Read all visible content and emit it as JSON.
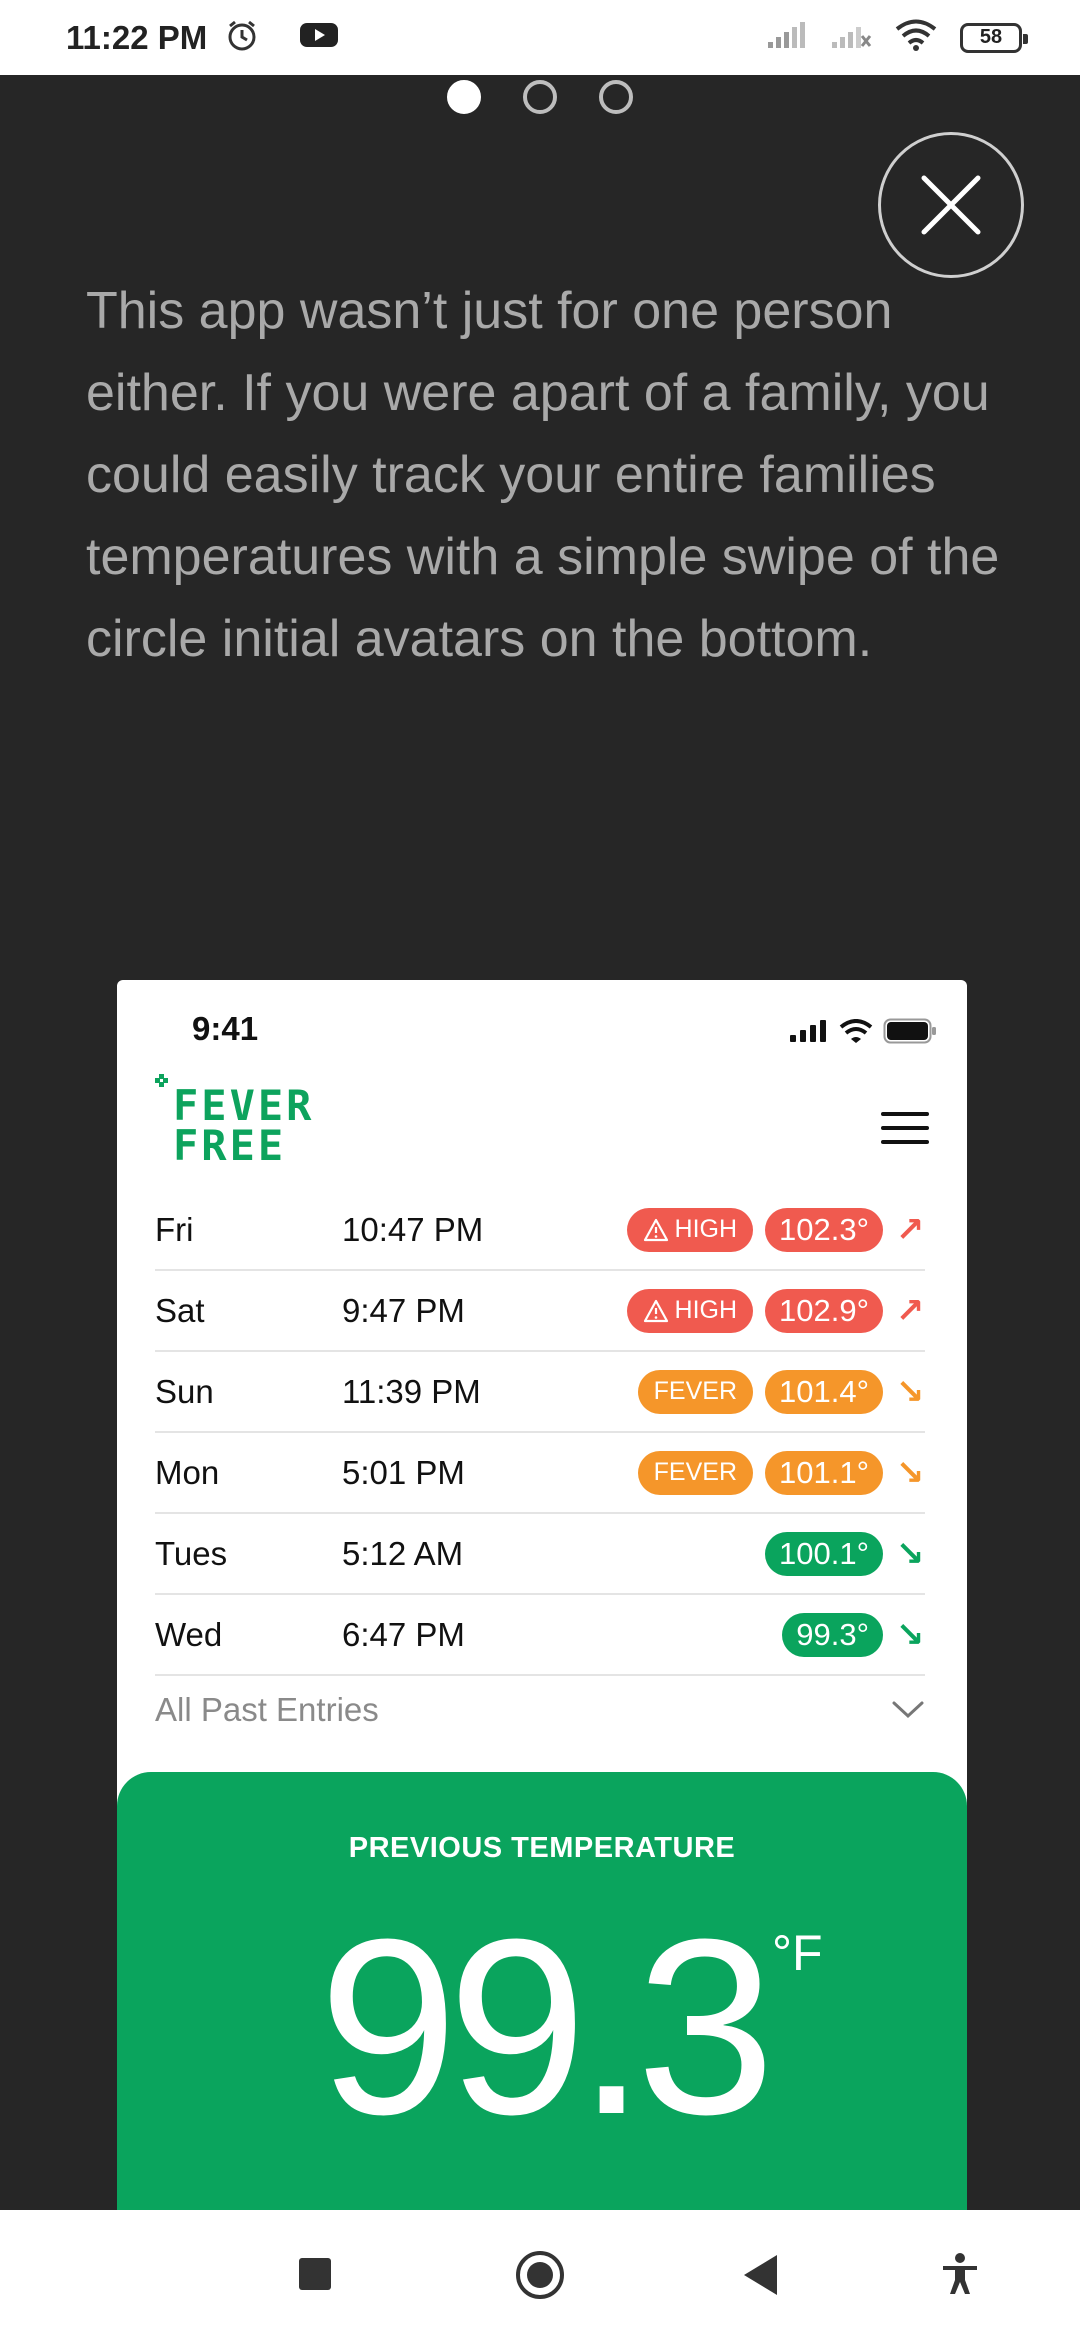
{
  "status_bar": {
    "time": "11:22 PM",
    "battery": "58",
    "icons": [
      "alarm-icon",
      "youtube-icon",
      "signal-icon",
      "signal-off-icon",
      "wifi-icon",
      "battery-icon"
    ]
  },
  "pager": {
    "total": 3,
    "active": 0
  },
  "close_icon": "close-icon",
  "story_text": "This app wasn’t just for one person either. If you were apart of a family, you could easily track your entire families temperatures with a simple swipe of the circle initial avatars on the bottom.",
  "phone": {
    "time": "9:41",
    "logo_line1": "FEVER",
    "logo_line2": "FREE",
    "entries": [
      {
        "day": "Fri",
        "time": "10:47 PM",
        "badge": "HIGH",
        "temp": "102.3°",
        "trend": "up"
      },
      {
        "day": "Sat",
        "time": "9:47 PM",
        "badge": "HIGH",
        "temp": "102.9°",
        "trend": "up"
      },
      {
        "day": "Sun",
        "time": "11:39 PM",
        "badge": "FEVER",
        "temp": "101.4°",
        "trend": "down"
      },
      {
        "day": "Mon",
        "time": "5:01 PM",
        "badge": "FEVER",
        "temp": "101.1°",
        "trend": "down"
      },
      {
        "day": "Tues",
        "time": "5:12 AM",
        "badge": "",
        "temp": "100.1°",
        "trend": "down"
      },
      {
        "day": "Wed",
        "time": "6:47 PM",
        "badge": "",
        "temp": "99.3°",
        "trend": "down"
      }
    ],
    "past_entries_label": "All Past Entries",
    "previous_label": "PREVIOUS TEMPERATURE",
    "previous_value": "99.3",
    "previous_unit": "°F"
  },
  "colors": {
    "background": "#262626",
    "green": "#0aa45d",
    "high_red": "#f05a4f",
    "fever_orange": "#f5962a"
  },
  "nav_bar": {
    "icons": [
      "recents-icon",
      "home-icon",
      "back-icon",
      "accessibility-icon"
    ]
  }
}
